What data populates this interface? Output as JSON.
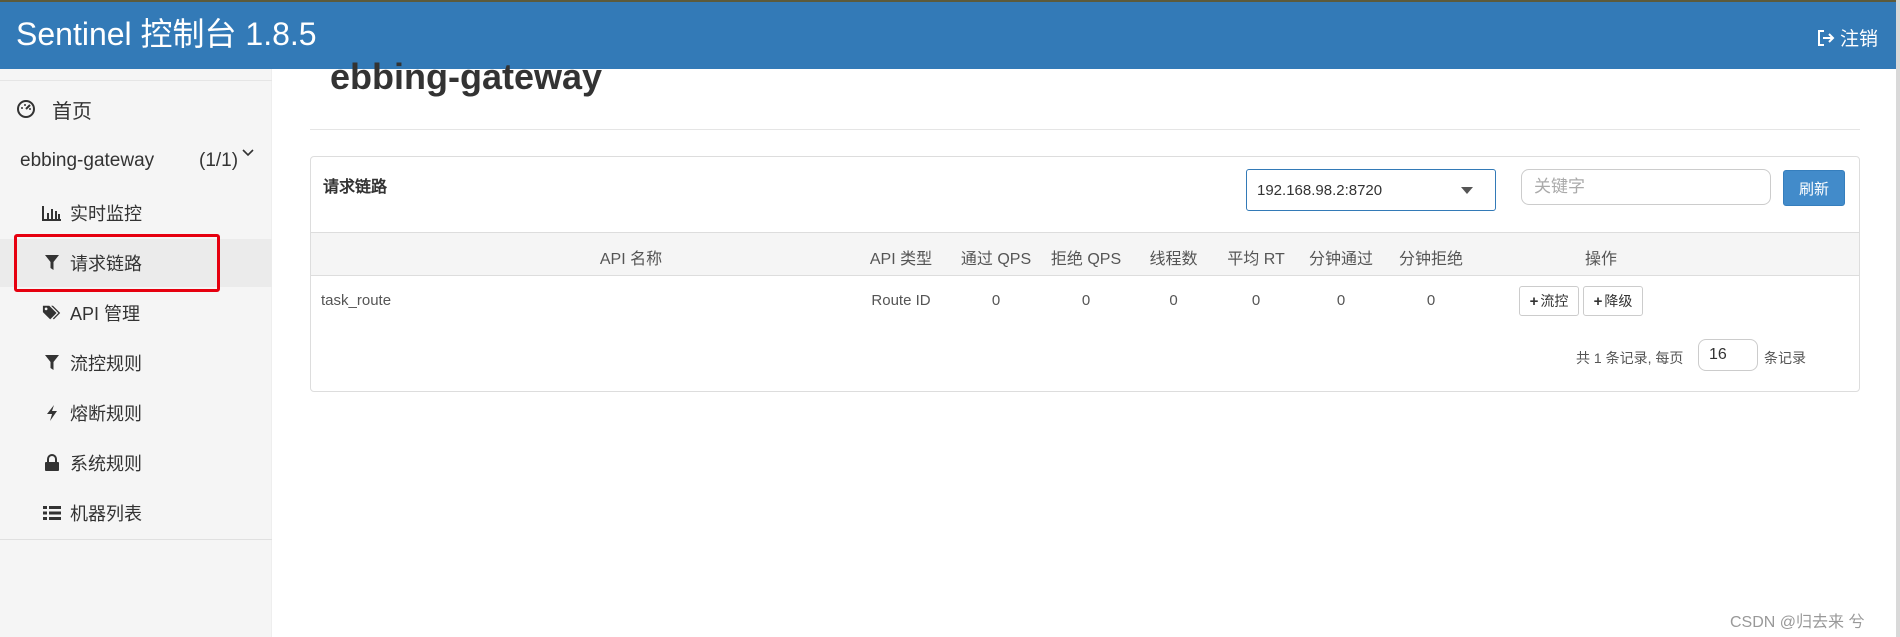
{
  "header": {
    "brand": "Sentinel 控制台 1.8.5",
    "logout_label": "注销"
  },
  "sidebar": {
    "home_label": "首页",
    "app_name": "ebbing-gateway",
    "app_count": "(1/1)",
    "items": [
      {
        "label": "实时监控",
        "icon": "bar-chart-icon"
      },
      {
        "label": "请求链路",
        "icon": "filter-icon",
        "active": true
      },
      {
        "label": "API 管理",
        "icon": "tags-icon"
      },
      {
        "label": "流控规则",
        "icon": "filter-icon"
      },
      {
        "label": "熔断规则",
        "icon": "flash-icon"
      },
      {
        "label": "系统规则",
        "icon": "lock-icon"
      },
      {
        "label": "机器列表",
        "icon": "list-icon"
      }
    ]
  },
  "main": {
    "page_title": "ebbing-gateway",
    "panel_title": "请求链路",
    "machine_select": "192.168.98.2:8720",
    "keyword_placeholder": "关键字",
    "refresh_label": "刷新",
    "columns": [
      "API 名称",
      "API 类型",
      "通过 QPS",
      "拒绝 QPS",
      "线程数",
      "平均 RT",
      "分钟通过",
      "分钟拒绝",
      "操作"
    ],
    "rows": [
      {
        "api_name": "task_route",
        "api_type": "Route ID",
        "pass_qps": "0",
        "block_qps": "0",
        "threads": "0",
        "avg_rt": "0",
        "minute_pass": "0",
        "minute_block": "0",
        "flow_btn": "流控",
        "degrade_btn": "降级"
      }
    ],
    "pager": {
      "prefix": "共 1 条记录, 每页",
      "page_size": "16",
      "suffix": "条记录"
    }
  },
  "watermark": "CSDN @归去来 兮",
  "colors": {
    "navbar": "#337ab7",
    "primary_button": "#428bca",
    "highlight": "#e6000f"
  }
}
